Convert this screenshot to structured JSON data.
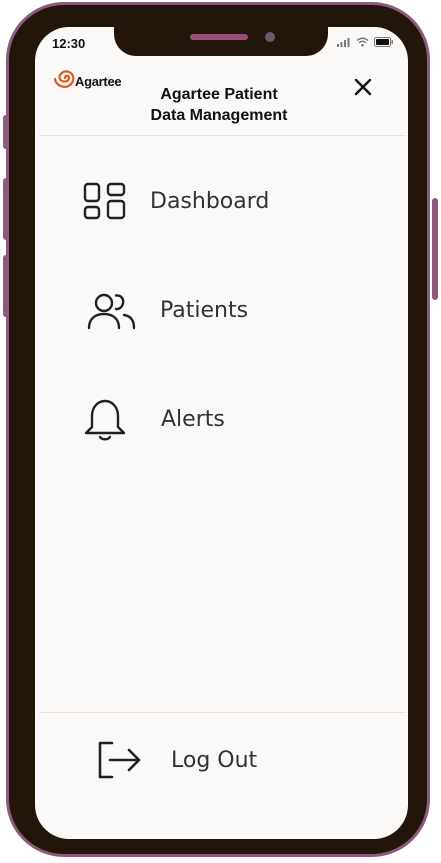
{
  "status_bar": {
    "time": "12:30"
  },
  "header": {
    "logo_text": "Agartee",
    "title_line1": "Agartee Patient",
    "title_line2": "Data Management",
    "close_icon": "close-icon"
  },
  "menu": {
    "items": [
      {
        "label": "Dashboard",
        "icon": "dashboard-icon"
      },
      {
        "label": "Patients",
        "icon": "users-icon"
      },
      {
        "label": "Alerts",
        "icon": "bell-icon"
      }
    ]
  },
  "footer": {
    "logout_label": "Log Out",
    "logout_icon": "logout-icon"
  },
  "colors": {
    "frame": "#8c5a7a",
    "bezel": "#221509",
    "screen": "#fbf9f8",
    "logo_accent": "#e05a1e"
  }
}
